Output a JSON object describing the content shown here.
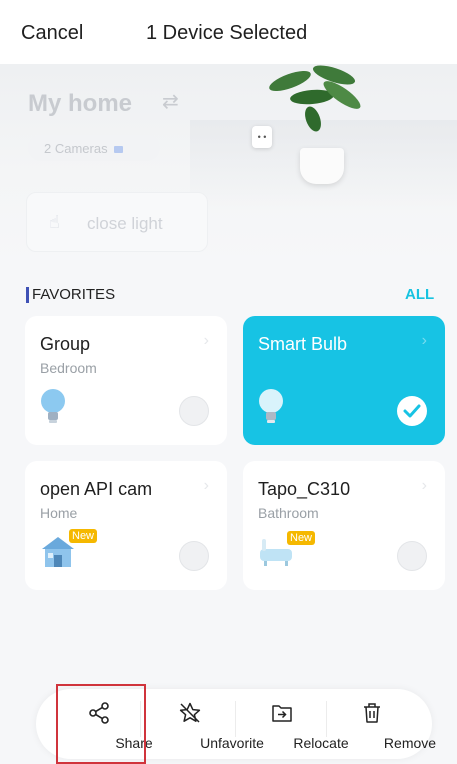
{
  "header": {
    "cancel_label": "Cancel",
    "title": "1 Device Selected"
  },
  "home": {
    "name": "My home",
    "cameras_chip": "2 Cameras",
    "scene_label": "close light"
  },
  "favorites": {
    "title": "FAVORITES",
    "all_label": "ALL",
    "devices": [
      {
        "name": "Group",
        "room": "Bedroom",
        "selected": false,
        "icon": "bulb-icon"
      },
      {
        "name": "Smart Bulb",
        "room": "",
        "selected": true,
        "icon": "bulb-icon"
      },
      {
        "name": "open API cam",
        "room": "Home",
        "selected": false,
        "icon": "house-icon",
        "badge": "New"
      },
      {
        "name": "Tapo_C310",
        "room": "Bathroom",
        "selected": false,
        "icon": "bathtub-icon",
        "badge": "New"
      }
    ]
  },
  "toolbar": {
    "share_label": "Share",
    "unfavorite_label": "Unfavorite",
    "relocate_label": "Relocate",
    "remove_label": "Remove"
  },
  "colors": {
    "accent": "#17c3e4",
    "favorites_bar": "#3f51b5",
    "highlight": "#d0343c",
    "new_badge": "#f5b800"
  }
}
